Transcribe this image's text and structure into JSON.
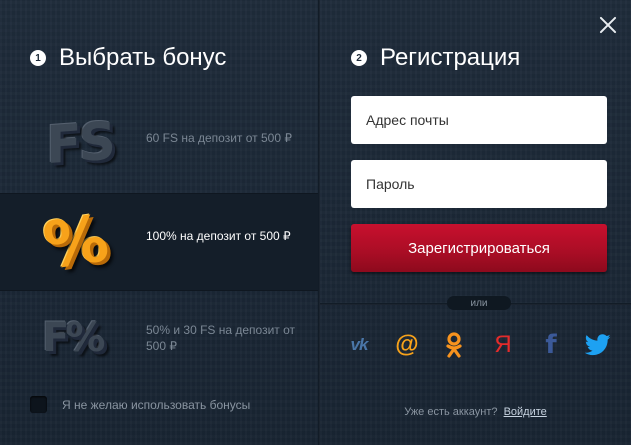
{
  "close_label": "×",
  "left": {
    "step": "1",
    "title": "Выбрать бонус",
    "bonuses": [
      {
        "text": "60 FS на депозит от 500 ₽",
        "icon": "fs-icon",
        "selected": false
      },
      {
        "text": "100% на депозит от 500 ₽",
        "icon": "percent-icon",
        "selected": true
      },
      {
        "text": "50% и 30 FS на депозит от 500 ₽",
        "icon": "fs-percent-icon",
        "selected": false
      }
    ],
    "no_bonus_label": "Я не желаю использовать бонусы"
  },
  "right": {
    "step": "2",
    "title": "Регистрация",
    "email_placeholder": "Адрес почты",
    "password_placeholder": "Пароль",
    "submit_label": "Зарегистрироваться",
    "or_label": "или",
    "social": [
      {
        "name": "vk-icon",
        "glyph": "vk"
      },
      {
        "name": "mail-icon",
        "glyph": "@"
      },
      {
        "name": "odnoklassniki-icon",
        "glyph": "ok"
      },
      {
        "name": "yandex-icon",
        "glyph": "Я"
      },
      {
        "name": "facebook-icon",
        "glyph": "f"
      },
      {
        "name": "twitter-icon",
        "glyph": "tw"
      }
    ],
    "have_account_text": "Уже есть аккаунт?",
    "login_link": "Войдите"
  },
  "colors": {
    "accent_red": "#c8102e",
    "bonus_orange": "#f7a21a",
    "background": "#1b2837"
  }
}
